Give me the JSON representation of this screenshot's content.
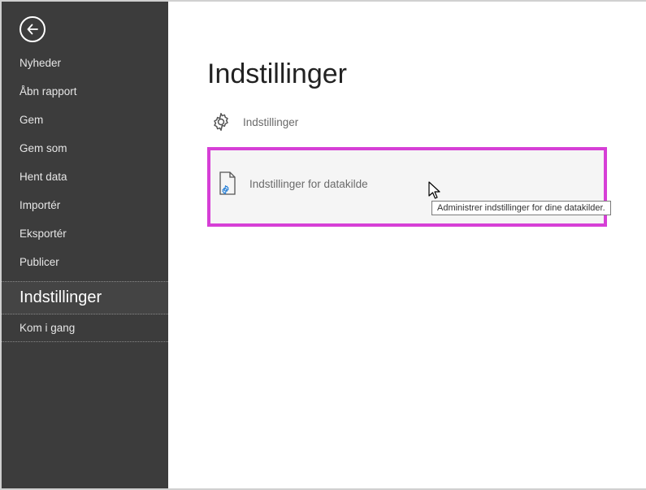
{
  "sidebar": {
    "items": [
      {
        "label": "Nyheder"
      },
      {
        "label": "Åbn rapport"
      },
      {
        "label": "Gem"
      },
      {
        "label": "Gem som"
      },
      {
        "label": "Hent data"
      },
      {
        "label": "Importér"
      },
      {
        "label": "Eksportér"
      },
      {
        "label": "Publicer"
      }
    ],
    "settings_label": "Indstillinger",
    "kom_i_gang_label": "Kom i gang"
  },
  "main": {
    "title": "Indstillinger",
    "option_settings_label": "Indstillinger",
    "option_datasource_label": "Indstillinger for datakilde",
    "tooltip_text": "Administrer indstillinger for dine datakilder."
  },
  "colors": {
    "sidebar_bg": "#3c3c3c",
    "highlight_border": "#d63fd6",
    "text_muted": "#6a6a6a"
  }
}
